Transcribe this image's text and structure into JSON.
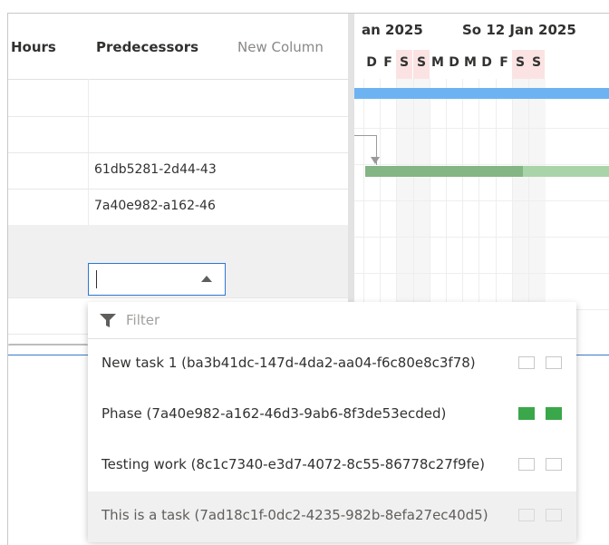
{
  "grid": {
    "columns": {
      "hours": "Hours",
      "predecessors": "Predecessors",
      "new_column": "New Column"
    },
    "rows": [
      {
        "predecessors": ""
      },
      {
        "predecessors": ""
      },
      {
        "predecessors": "61db5281-2d44-43"
      },
      {
        "predecessors": "7a40e982-a162-46"
      },
      {
        "predecessors": ""
      },
      {
        "predecessors": ""
      },
      {
        "predecessors": ""
      }
    ]
  },
  "gantt": {
    "months": [
      "an 2025",
      "So 12 Jan 2025"
    ],
    "days": [
      "D",
      "F",
      "S",
      "S",
      "M",
      "D",
      "M",
      "D",
      "F",
      "S",
      "S"
    ],
    "weekend_color": "#fbe3e3",
    "phase_bar_color": "#6db3f2",
    "task_bar_color": "#84b584"
  },
  "combo": {
    "value": ""
  },
  "dropdown": {
    "filter_placeholder": "Filter",
    "options": [
      {
        "label": "New task 1 (ba3b41dc-147d-4da2-aa04-f6c80e8c3f78)",
        "checked": false
      },
      {
        "label": "Phase (7a40e982-a162-46d3-9ab6-8f3de53ecded)",
        "checked": true
      },
      {
        "label": "Testing work (8c1c7340-e3d7-4072-8c55-86778c27f9fe)",
        "checked": false
      },
      {
        "label": "This is a task (7ad18c1f-0dc2-4235-982b-8efa27ec40d5)",
        "checked": false
      }
    ],
    "check_color": "#3aa74a"
  }
}
